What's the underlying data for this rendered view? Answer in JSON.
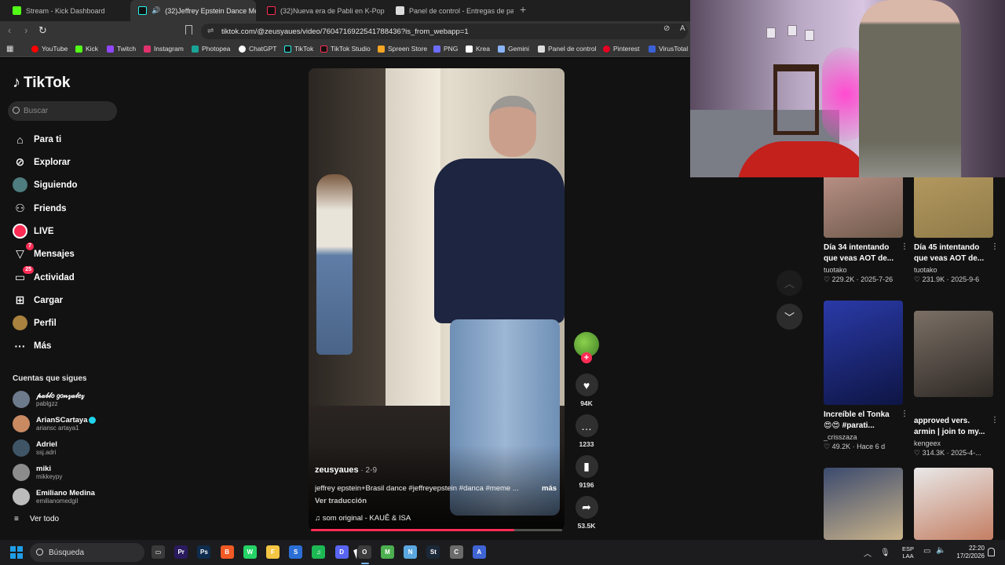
{
  "browser": {
    "tabs": [
      {
        "title": "Stream - Kick Dashboard",
        "active": false
      },
      {
        "title": "(32)Jeffrey Epstein Dance Me",
        "active": true
      },
      {
        "title": "(32)Nueva era de Pabli en K-Pop | Til",
        "active": false
      },
      {
        "title": "Panel de control - Entregas de pago",
        "active": false
      }
    ],
    "url": "tiktok.com/@zeusyaues/video/7604716922541788436?is_from_webapp=1",
    "bookmarks": [
      "YouTube",
      "Kick",
      "Twitch",
      "Instagram",
      "Photopea",
      "ChatGPT",
      "TikTok",
      "TikTok Studio",
      "Spreen Store",
      "PNG",
      "Krea",
      "Gemini",
      "Panel de control",
      "Pinterest",
      "VirusTotal"
    ],
    "bookmark_colors": [
      "#ff0000",
      "#53fc18",
      "#9146ff",
      "#e1306c",
      "#18a497",
      "#ffffff",
      "#ffffff",
      "#ffffff",
      "#f5a623",
      "#6c6cff",
      "#ffffff",
      "#8ab4f8",
      "#dddddd",
      "#e60023",
      "#3b61d6"
    ]
  },
  "tiktok": {
    "logo": "TikTok",
    "search_placeholder": "Buscar",
    "nav": [
      {
        "label": "Para ti",
        "icon": "home-icon"
      },
      {
        "label": "Explorar",
        "icon": "compass-icon"
      },
      {
        "label": "Siguiendo",
        "icon": "following-avatar-icon"
      },
      {
        "label": "Friends",
        "icon": "friends-icon"
      },
      {
        "label": "LIVE",
        "icon": "live-icon"
      },
      {
        "label": "Mensajes",
        "icon": "messages-icon",
        "badge": "7"
      },
      {
        "label": "Actividad",
        "icon": "activity-icon",
        "badge": "25"
      },
      {
        "label": "Cargar",
        "icon": "upload-icon"
      },
      {
        "label": "Perfil",
        "icon": "profile-avatar-icon"
      },
      {
        "label": "Más",
        "icon": "more-icon"
      }
    ],
    "following_title": "Cuentas que sigues",
    "following": [
      {
        "name": "𝓅𝒶𝒷𝓁𝑜 𝑔𝑜𝓃𝓏𝒶𝓁𝑒𝓏",
        "handle": "pablgzz",
        "verified": false,
        "color": "#6d7a8c"
      },
      {
        "name": "ArianSCartaya",
        "handle": "ariansc artaya1",
        "verified": true,
        "color": "#c98a62"
      },
      {
        "name": "Adriel",
        "handle": "ssj.adri",
        "verified": false,
        "color": "#3f5566"
      },
      {
        "name": "miki",
        "handle": "mikkeypy",
        "verified": false,
        "color": "#8c8c8c"
      },
      {
        "name": "Emiliano Medina",
        "handle": "emilianomedgil",
        "verified": false,
        "color": "#bcbcbc"
      }
    ],
    "see_all": "Ver todo",
    "video": {
      "author": "zeusyaues",
      "date": "2-9",
      "caption": "jeffrey epstein+Brasil dance #jeffreyepstein #danca #meme ...",
      "more": "más",
      "translate": "Ver traducción",
      "sound": "som original - KAUÊ & ISA",
      "progress": 0.81
    },
    "actions": {
      "likes": "94K",
      "comments": "1233",
      "saves": "9196",
      "shares": "53.5K"
    },
    "recommended": [
      {
        "title": "Día 34 intentando\nque veas AOT de...",
        "author": "tuotako",
        "meta": "♡ 229.2K · 2025-7-26",
        "color1": "#d9a8a0",
        "color2": "#6f5a4b"
      },
      {
        "title": "Día 45 intentando\nque veas AOT de...",
        "author": "tuotako",
        "meta": "♡ 231.9K · 2025-9-6",
        "color1": "#c4a76a",
        "color2": "#8f7a48"
      },
      {
        "title": "Increíble el Tonka\n😍😍 #parati...",
        "author": "_crisszaza",
        "meta": "♡ 49.2K · Hace 6 d",
        "color1": "#2a3aa8",
        "color2": "#0e1544"
      },
      {
        "title": "approved vers.\narmin | join to my...",
        "author": "kengeex",
        "meta": "♡ 314.3K · 2025-4-...",
        "color1": "#7b6f65",
        "color2": "#2e2925"
      },
      {
        "title": "",
        "author": "",
        "meta": "",
        "color1": "#3b4a6e",
        "color2": "#c9b38a"
      },
      {
        "title": "",
        "author": "",
        "meta": "",
        "color1": "#e8e8e8",
        "color2": "#c47e63"
      }
    ]
  },
  "taskbar": {
    "search_placeholder": "Búsqueda",
    "apps": [
      {
        "name": "task-view-icon",
        "label": "▭",
        "color": "#3a3a3a"
      },
      {
        "name": "premiere-icon",
        "label": "Pr",
        "color": "#2a1a5e"
      },
      {
        "name": "photoshop-icon",
        "label": "Ps",
        "color": "#0e2c4e"
      },
      {
        "name": "brave-icon",
        "label": "B",
        "color": "#f15a24"
      },
      {
        "name": "whatsapp-icon",
        "label": "W",
        "color": "#25d366"
      },
      {
        "name": "file-explorer-icon",
        "label": "F",
        "color": "#f4c542"
      },
      {
        "name": "store-icon",
        "label": "S",
        "color": "#2b6fd6"
      },
      {
        "name": "spotify-icon",
        "label": "♫",
        "color": "#1db954"
      },
      {
        "name": "discord-icon",
        "label": "D",
        "color": "#5865f2"
      },
      {
        "name": "obs-icon",
        "label": "O",
        "color": "#3c3c3c"
      },
      {
        "name": "minecraft-icon",
        "label": "M",
        "color": "#4caf50"
      },
      {
        "name": "notepad-icon",
        "label": "N",
        "color": "#5aa7e0"
      },
      {
        "name": "steam-icon",
        "label": "St",
        "color": "#1b2838"
      },
      {
        "name": "calculator-icon",
        "label": "C",
        "color": "#6b6b6b"
      },
      {
        "name": "app-icon",
        "label": "A",
        "color": "#3f64d4"
      }
    ],
    "lang_line1": "ESP",
    "lang_line2": "LAA",
    "time": "22:20",
    "date": "17/2/2026"
  }
}
